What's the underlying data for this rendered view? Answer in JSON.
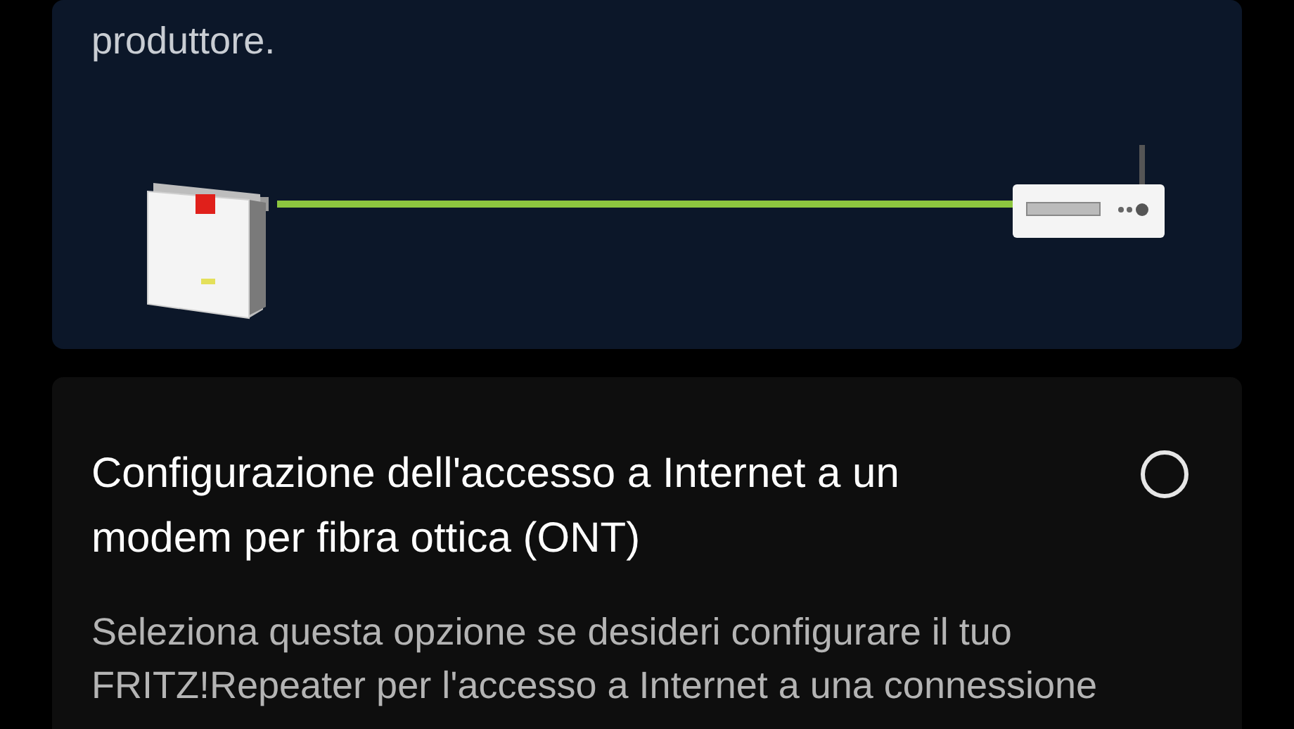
{
  "setup_card": {
    "description_end": "produttore."
  },
  "options": [
    {
      "title": "Configurazione dell'accesso a Internet a un modem per fibra ottica (ONT)",
      "selected": false,
      "description": "Seleziona questa opzione se desideri configurare il tuo FRITZ!Repeater per l'accesso a Internet a una connessione"
    }
  ]
}
